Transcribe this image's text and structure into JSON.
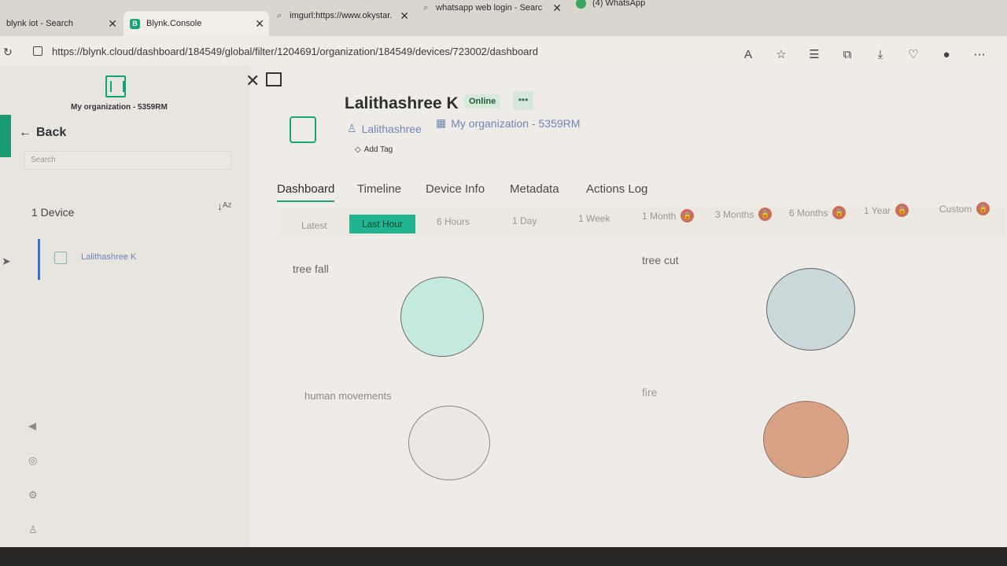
{
  "browser": {
    "tabs": [
      {
        "title": "blynk iot - Search",
        "active": false
      },
      {
        "title": "Blynk.Console",
        "active": true,
        "favicon": "B"
      },
      {
        "title": "imgurl:https://www.okystar...",
        "active": false
      },
      {
        "title": "whatsapp web login - Search",
        "active": false
      },
      {
        "title": "(4) WhatsApp",
        "active": false
      }
    ],
    "url": "https://blynk.cloud/dashboard/184549/global/filter/1204691/organization/184549/devices/723002/dashboard",
    "toolbar_icons": [
      "read-aloud-icon",
      "favorite-star-icon",
      "favorites-list-icon",
      "collections-icon",
      "downloads-icon",
      "browser-essentials-icon",
      "profile-icon",
      "more-icon"
    ]
  },
  "sidebar": {
    "org_name": "My organization - 5359RM",
    "back_label": "Back",
    "search_placeholder": "Search",
    "device_count": "1 Device",
    "devices": [
      {
        "name": "Lalithashree K"
      }
    ]
  },
  "device": {
    "name": "Lalithashree K",
    "status": "Online",
    "owner": "Lalithashree",
    "organization": "My organization - 5359RM",
    "add_tag": "Add Tag"
  },
  "tabs": [
    "Dashboard",
    "Timeline",
    "Device Info",
    "Metadata",
    "Actions Log"
  ],
  "active_tab": "Dashboard",
  "time_ranges": [
    {
      "label": "Latest",
      "locked": false
    },
    {
      "label": "Last Hour",
      "locked": false,
      "active": true
    },
    {
      "label": "6 Hours",
      "locked": false
    },
    {
      "label": "1 Day",
      "locked": false
    },
    {
      "label": "1 Week",
      "locked": false
    },
    {
      "label": "1 Month",
      "locked": true
    },
    {
      "label": "3 Months",
      "locked": true
    },
    {
      "label": "6 Months",
      "locked": true
    },
    {
      "label": "1 Year",
      "locked": true
    },
    {
      "label": "Custom",
      "locked": true
    }
  ],
  "widgets": [
    {
      "label": "tree fall",
      "color": "#c4e9df"
    },
    {
      "label": "tree cut",
      "color": "#cbd8da"
    },
    {
      "label": "human movements",
      "color": "#ebe8e3"
    },
    {
      "label": "fire",
      "color": "#d8a284"
    }
  ],
  "colors": {
    "accent": "#1aa37a",
    "online_badge": "#d7ead9",
    "link": "#6c87b6",
    "lock": "#cc6f5a"
  }
}
